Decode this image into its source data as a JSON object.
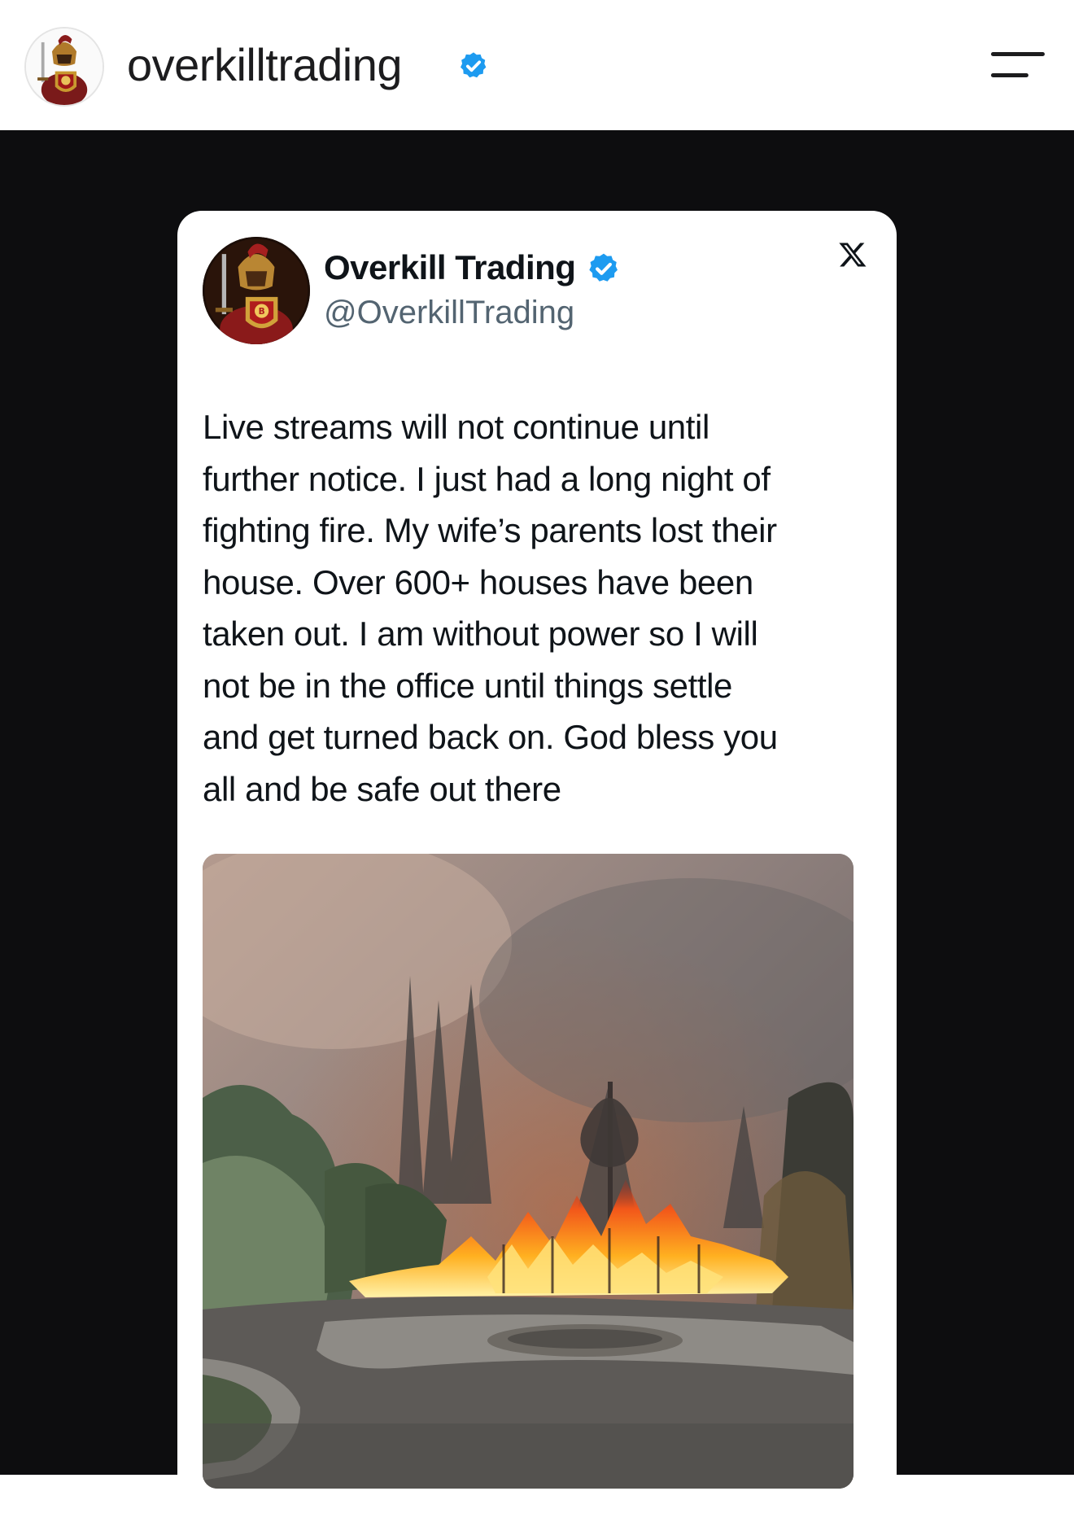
{
  "header": {
    "username": "overkilltrading",
    "avatar_icon": "spartan-warrior-bitcoin-shield-icon",
    "verified_icon": "verified-badge-icon",
    "menu_icon": "hamburger-menu-icon"
  },
  "tweet": {
    "display_name": "Overkill Trading",
    "handle": "@OverkillTrading",
    "platform_icon": "x-logo-icon",
    "text_lines": [
      "Live streams will not continue until",
      "further notice. I just had a long night of",
      "fighting fire. My wife’s parents lost their",
      "house. Over 600+ houses have been",
      "taken out. I am without power so I will",
      "not be in the office until things settle",
      "and get turned back on. God bless you",
      "all and be safe out there"
    ],
    "photo_icon": "wildfire-photo"
  },
  "colors": {
    "verified_blue": "#1d9bf0",
    "post_background": "#0d0d0f",
    "text_primary": "#0f1419",
    "text_secondary": "#536471"
  }
}
